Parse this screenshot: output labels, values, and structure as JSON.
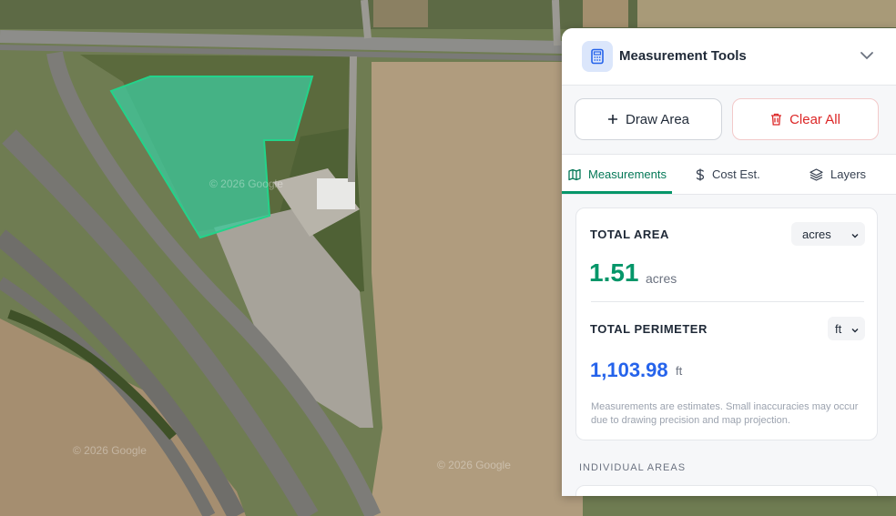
{
  "map": {
    "watermarks": [
      "© 2026 Google",
      "© 2026 Google",
      "© 2026 Google"
    ],
    "colors": {
      "polygon_fill": "#3fc79a",
      "polygon_stroke": "#23d38a"
    }
  },
  "panel": {
    "title": "Measurement Tools",
    "title_icon": "calculator-icon",
    "buttons": {
      "draw_area": "Draw Area",
      "clear_all": "Clear All"
    },
    "tabs": [
      {
        "label": "Measurements",
        "icon": "map-icon",
        "active": true
      },
      {
        "label": "Cost Est.",
        "icon": "dollar-icon",
        "active": false
      },
      {
        "label": "Layers",
        "icon": "layers-icon",
        "active": false
      }
    ],
    "total_area": {
      "label": "TOTAL AREA",
      "unit_select": "acres",
      "value": "1.51",
      "unit": "acres"
    },
    "total_perimeter": {
      "label": "TOTAL PERIMETER",
      "unit_select": "ft",
      "value": "1,103.98",
      "unit": "ft"
    },
    "note": "Measurements are estimates. Small inaccuracies may occur due to drawing precision and map projection.",
    "individual_areas_label": "INDIVIDUAL AREAS"
  },
  "colors": {
    "accent_green": "#059669",
    "area_value": "#059669",
    "perimeter_value": "#2563eb",
    "danger": "#dc2626"
  }
}
